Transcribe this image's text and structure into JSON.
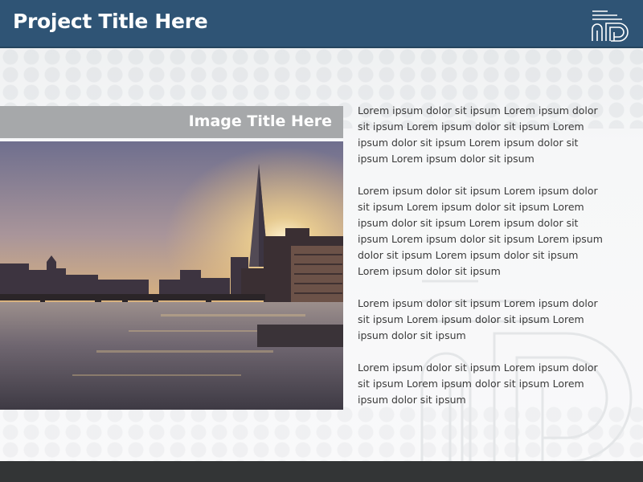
{
  "header": {
    "title": "Project Title Here",
    "background_color": "#2f5475"
  },
  "image_panel": {
    "title": "Image Title Here",
    "title_bar_color": "#a6a8aa",
    "photo_subject": "City river skyline at sunset with bridges and a tall spire tower"
  },
  "body_text": {
    "paragraphs": [
      "Lorem ipsum dolor sit ipsum Lorem ipsum dolor sit ipsum Lorem ipsum dolor sit ipsum Lorem ipsum dolor sit ipsum Lorem ipsum dolor sit ipsum Lorem ipsum dolor sit ipsum",
      "Lorem ipsum dolor sit ipsum Lorem ipsum dolor sit ipsum Lorem ipsum dolor sit ipsum Lorem ipsum dolor sit ipsum Lorem ipsum dolor sit ipsum Lorem ipsum dolor sit ipsum Lorem ipsum dolor sit ipsum Lorem ipsum dolor sit ipsum Lorem ipsum dolor sit ipsum",
      "Lorem ipsum dolor sit ipsum Lorem ipsum dolor sit ipsum Lorem ipsum dolor sit ipsum Lorem ipsum dolor sit ipsum",
      "Lorem ipsum dolor sit ipsum Lorem ipsum dolor sit ipsum Lorem ipsum dolor sit ipsum Lorem ipsum dolor sit ipsum"
    ]
  },
  "branding": {
    "logo_icon": "company-logo-icon",
    "watermark_icon": "logo-watermark-icon"
  },
  "footer": {
    "background_color": "#333536"
  }
}
